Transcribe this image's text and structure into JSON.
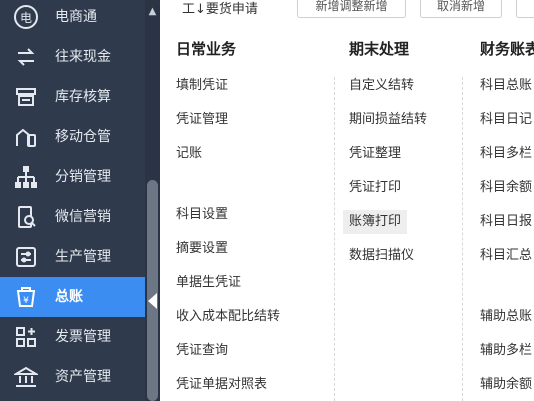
{
  "sidebar": {
    "items": [
      {
        "label": "电商通",
        "icon": "ecommerce-icon"
      },
      {
        "label": "往来现金",
        "icon": "transfer-icon"
      },
      {
        "label": "库存核算",
        "icon": "inventory-icon"
      },
      {
        "label": "移动仓管",
        "icon": "mobile-warehouse-icon"
      },
      {
        "label": "分销管理",
        "icon": "distribution-icon"
      },
      {
        "label": "微信营销",
        "icon": "wechat-icon"
      },
      {
        "label": "生产管理",
        "icon": "production-icon"
      },
      {
        "label": "总账",
        "icon": "ledger-icon",
        "active": true
      },
      {
        "label": "发票管理",
        "icon": "invoice-icon"
      },
      {
        "label": "资产管理",
        "icon": "asset-icon"
      }
    ],
    "active_color": "#3c8df2",
    "bg_color": "#2f3a4c"
  },
  "topbar": {
    "label": "工↓要货申请",
    "buttons": [
      "新增调整新增",
      "取消新增",
      ""
    ]
  },
  "menu": {
    "columns": [
      {
        "heading": "日常业务",
        "items": [
          "填制凭证",
          "凭证管理",
          "记账",
          "科目设置",
          "摘要设置",
          "单据生凭证",
          "收入成本配比结转",
          "凭证查询",
          "凭证单据对照表"
        ]
      },
      {
        "heading": "期末处理",
        "items": [
          "自定义结转",
          "期间损益结转",
          "凭证整理",
          "凭证打印",
          "账簿打印",
          "数据扫描仪"
        ]
      },
      {
        "heading": "财务账表",
        "items": [
          "科目总账",
          "科目日记",
          "科目多栏",
          "科目余额",
          "科目日报",
          "科目汇总",
          "辅助总账",
          "辅助多栏",
          "辅助余额"
        ]
      }
    ],
    "highlighted": "账簿打印"
  }
}
